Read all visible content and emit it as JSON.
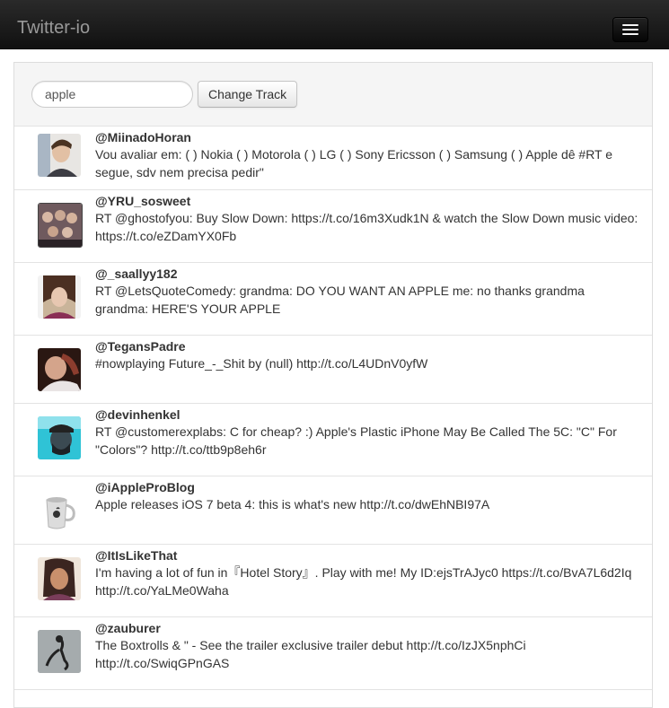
{
  "app": {
    "title": "Twitter-io"
  },
  "search": {
    "value": "apple",
    "button_label": "Change Track"
  },
  "tweets": [
    {
      "handle": "@MiinadoHoran",
      "text": "Vou avaliar em: ( ) Nokia ( ) Motorola ( ) LG ( ) Sony Ericsson ( ) Samsung ( ) Apple dê #RT e segue, sdv nem precisa pedir\""
    },
    {
      "handle": "@YRU_sosweet",
      "text": "RT @ghostofyou: Buy Slow Down: https://t.co/16m3Xudk1N & watch the Slow Down music video: https://t.co/eZDamYX0Fb"
    },
    {
      "handle": "@_saallyy182",
      "text": "RT @LetsQuoteComedy: grandma: DO YOU WANT AN APPLE me: no thanks grandma grandma: HERE'S YOUR APPLE"
    },
    {
      "handle": "@TegansPadre",
      "text": "#nowplaying Future_-_Shit by (null) http://t.co/L4UDnV0yfW"
    },
    {
      "handle": "@devinhenkel",
      "text": "RT @customerexplabs: C for cheap? :) Apple's Plastic iPhone May Be Called The 5C: \"C\" For \"Colors\"? http://t.co/ttb9p8eh6r"
    },
    {
      "handle": "@iAppleProBlog",
      "text": "Apple releases iOS 7 beta 4: this is what's new http://t.co/dwEhNBI97A"
    },
    {
      "handle": "@ItIsLikeThat",
      "text": "I'm having a lot of fun in『Hotel Story』. Play with me! My ID:ejsTrAJyc0 https://t.co/BvA7L6d2Iq http://t.co/YaLMe0Waha"
    },
    {
      "handle": "@zauburer",
      "text": "The Boxtrolls & \" - See the trailer exclusive trailer debut http://t.co/IzJX5nphCi http://t.co/SwiqGPnGAS"
    }
  ],
  "colors": {
    "navbar": "#1b1b1b",
    "brand_text": "#999999",
    "panel_bg": "#f5f5f5",
    "border": "#dddddd"
  }
}
